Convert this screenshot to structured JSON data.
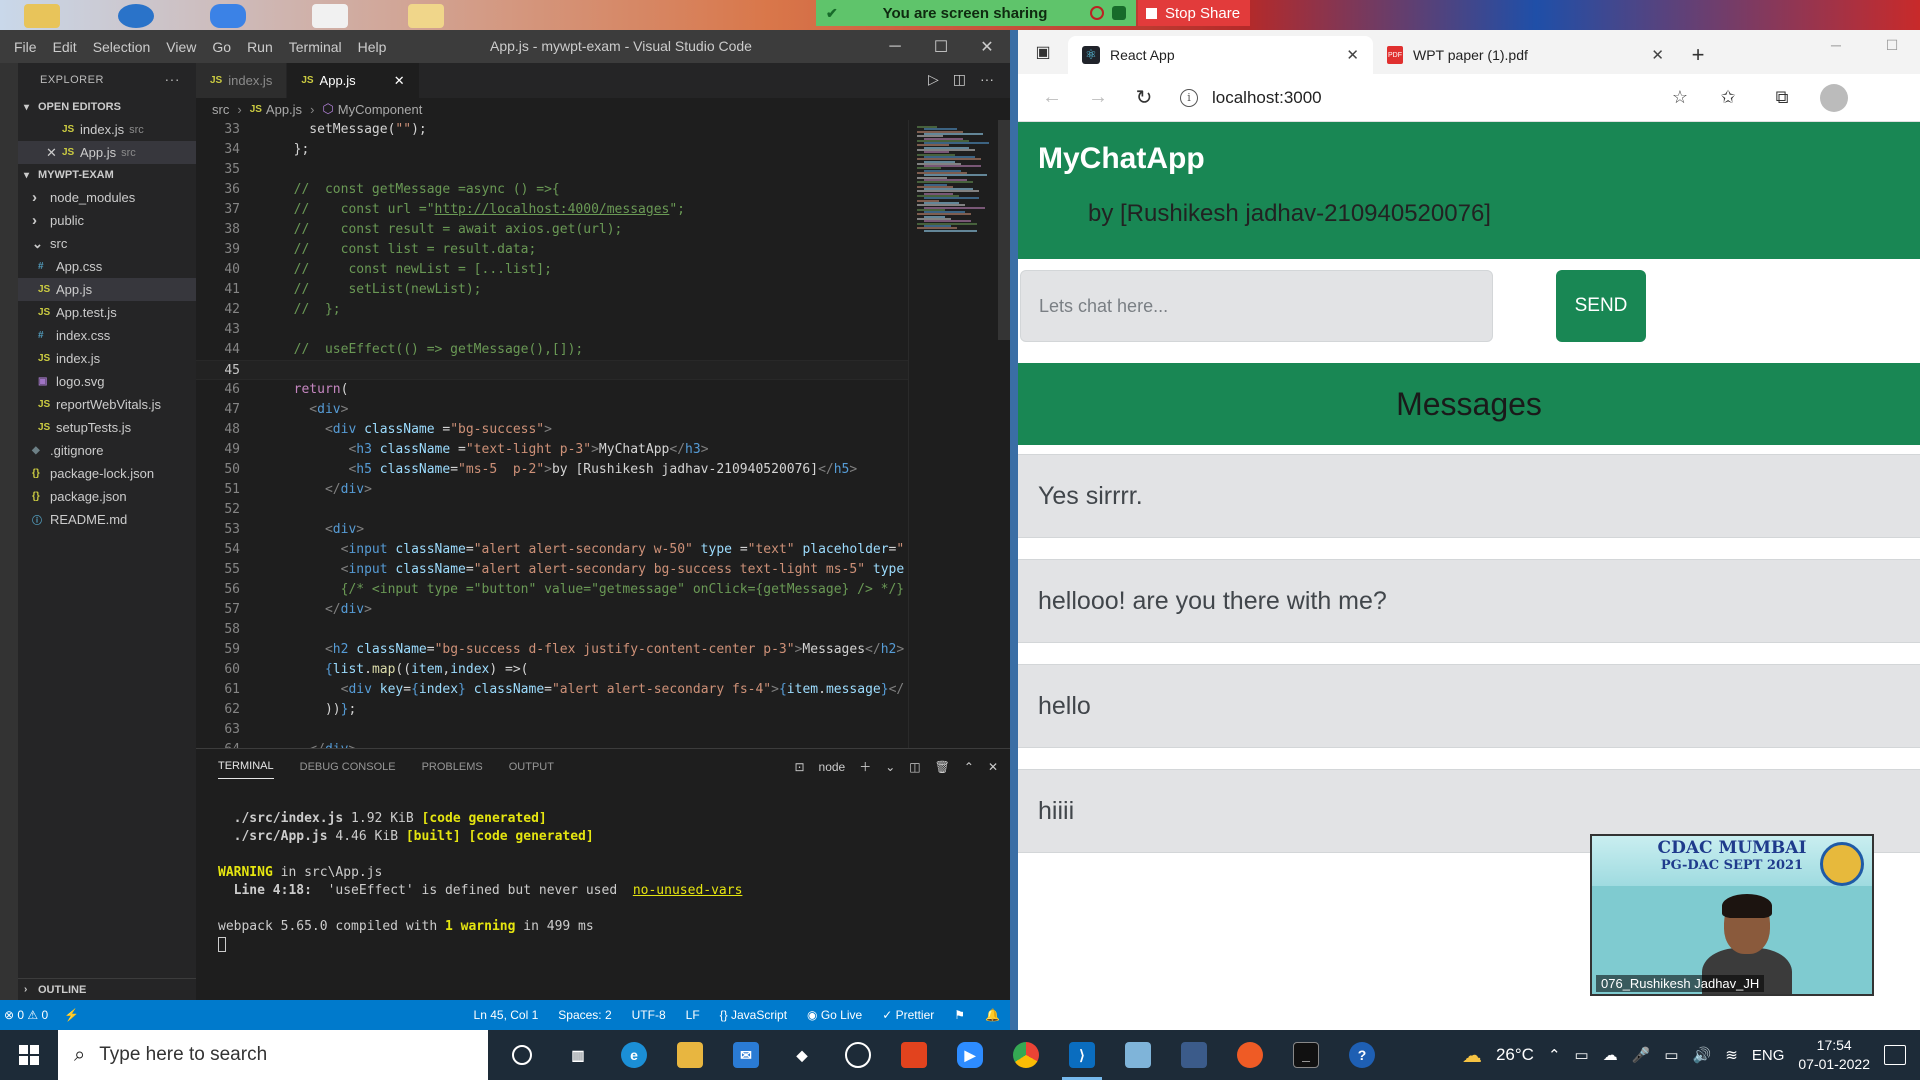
{
  "colors": {
    "vscode_bg": "#1e1e1e",
    "status_bar": "#007acc",
    "bootstrap_success": "#198754",
    "alert_secondary": "#e2e3e5",
    "share_green": "#5fc46b",
    "stop_red": "#e23b3b"
  },
  "screen_share": {
    "message": "You are screen sharing",
    "stop_label": "Stop Share"
  },
  "vscode": {
    "menu": [
      "File",
      "Edit",
      "Selection",
      "View",
      "Go",
      "Run",
      "Terminal",
      "Help"
    ],
    "window_title": "App.js - mywpt-exam - Visual Studio Code",
    "explorer": {
      "header": "EXPLORER",
      "open_editors_label": "OPEN EDITORS",
      "open_editors": [
        {
          "name": "index.js",
          "hint": "src",
          "icon": "js-icon"
        },
        {
          "name": "App.js",
          "hint": "src",
          "icon": "js-icon"
        }
      ],
      "project_label": "MYWPT-EXAM",
      "tree": [
        {
          "name": "node_modules",
          "kind": "folder",
          "depth": 1
        },
        {
          "name": "public",
          "kind": "folder",
          "depth": 1
        },
        {
          "name": "src",
          "kind": "folder-open",
          "depth": 1
        },
        {
          "name": "App.css",
          "kind": "css",
          "depth": 2
        },
        {
          "name": "App.js",
          "kind": "js",
          "depth": 2,
          "selected": true
        },
        {
          "name": "App.test.js",
          "kind": "js",
          "depth": 2
        },
        {
          "name": "index.css",
          "kind": "css",
          "depth": 2
        },
        {
          "name": "index.js",
          "kind": "js",
          "depth": 2
        },
        {
          "name": "logo.svg",
          "kind": "svg",
          "depth": 2
        },
        {
          "name": "reportWebVitals.js",
          "kind": "js",
          "depth": 2
        },
        {
          "name": "setupTests.js",
          "kind": "js",
          "depth": 2
        },
        {
          "name": ".gitignore",
          "kind": "git",
          "depth": 1
        },
        {
          "name": "package-lock.json",
          "kind": "json",
          "depth": 1
        },
        {
          "name": "package.json",
          "kind": "json",
          "depth": 1
        },
        {
          "name": "README.md",
          "kind": "info",
          "depth": 1
        }
      ],
      "outline_label": "OUTLINE"
    },
    "tabs": [
      {
        "label": "index.js",
        "active": false
      },
      {
        "label": "App.js",
        "active": true
      }
    ],
    "breadcrumb": [
      "src",
      "App.js",
      "MyComponent"
    ],
    "current_line": 45,
    "code_lines": [
      {
        "n": 33,
        "parts": [
          [
            "txt",
            "    setMessage("
          ],
          [
            "str",
            "\"\""
          ],
          [
            "txt",
            ");"
          ]
        ]
      },
      {
        "n": 34,
        "parts": [
          [
            "txt",
            "  };"
          ]
        ]
      },
      {
        "n": 35,
        "parts": []
      },
      {
        "n": 36,
        "parts": [
          [
            "com",
            "  //  const getMessage =async () =>{"
          ]
        ]
      },
      {
        "n": 37,
        "parts": [
          [
            "com",
            "  //    const url =\""
          ],
          [
            "link",
            "http://localhost:4000/messages"
          ],
          [
            "com",
            "\";"
          ]
        ]
      },
      {
        "n": 38,
        "parts": [
          [
            "com",
            "  //    const result = await axios.get(url);"
          ]
        ]
      },
      {
        "n": 39,
        "parts": [
          [
            "com",
            "  //    const list = result.data;"
          ]
        ]
      },
      {
        "n": 40,
        "parts": [
          [
            "com",
            "  //     const newList = [...list];"
          ]
        ]
      },
      {
        "n": 41,
        "parts": [
          [
            "com",
            "  //     setList(newList);"
          ]
        ]
      },
      {
        "n": 42,
        "parts": [
          [
            "com",
            "  //  };"
          ]
        ]
      },
      {
        "n": 43,
        "parts": []
      },
      {
        "n": 44,
        "parts": [
          [
            "com",
            "  //  useEffect(() => getMessage(),[]);"
          ]
        ]
      },
      {
        "n": 45,
        "parts": []
      },
      {
        "n": 46,
        "parts": [
          [
            "kw",
            "  return"
          ],
          [
            "txt",
            "("
          ]
        ]
      },
      {
        "n": 47,
        "parts": [
          [
            "tagbr",
            "    <"
          ],
          [
            "tag",
            "div"
          ],
          [
            "tagbr",
            ">"
          ]
        ]
      },
      {
        "n": 48,
        "parts": [
          [
            "tagbr",
            "      <"
          ],
          [
            "tag",
            "div"
          ],
          [
            "attr",
            " className "
          ],
          [
            "txt",
            "="
          ],
          [
            "str",
            "\"bg-success\""
          ],
          [
            "tagbr",
            ">"
          ]
        ]
      },
      {
        "n": 49,
        "parts": [
          [
            "tagbr",
            "         <"
          ],
          [
            "tag",
            "h3"
          ],
          [
            "attr",
            " className "
          ],
          [
            "txt",
            "="
          ],
          [
            "str",
            "\"text-light p-3\""
          ],
          [
            "tagbr",
            ">"
          ],
          [
            "txt",
            "MyChatApp"
          ],
          [
            "tagbr",
            "</"
          ],
          [
            "tag",
            "h3"
          ],
          [
            "tagbr",
            ">"
          ]
        ]
      },
      {
        "n": 50,
        "parts": [
          [
            "tagbr",
            "         <"
          ],
          [
            "tag",
            "h5"
          ],
          [
            "attr",
            " className"
          ],
          [
            "txt",
            "="
          ],
          [
            "str",
            "\"ms-5  p-2\""
          ],
          [
            "tagbr",
            ">"
          ],
          [
            "txt",
            "by [Rushikesh jadhav-210940520076]"
          ],
          [
            "tagbr",
            "</"
          ],
          [
            "tag",
            "h5"
          ],
          [
            "tagbr",
            ">"
          ]
        ]
      },
      {
        "n": 51,
        "parts": [
          [
            "tagbr",
            "      </"
          ],
          [
            "tag",
            "div"
          ],
          [
            "tagbr",
            ">"
          ]
        ]
      },
      {
        "n": 52,
        "parts": []
      },
      {
        "n": 53,
        "parts": [
          [
            "tagbr",
            "      <"
          ],
          [
            "tag",
            "div"
          ],
          [
            "tagbr",
            ">"
          ]
        ]
      },
      {
        "n": 54,
        "parts": [
          [
            "tagbr",
            "        <"
          ],
          [
            "tag",
            "input"
          ],
          [
            "attr",
            " className"
          ],
          [
            "txt",
            "="
          ],
          [
            "str",
            "\"alert alert-secondary w-50\""
          ],
          [
            "attr",
            " type "
          ],
          [
            "txt",
            "="
          ],
          [
            "str",
            "\"text\""
          ],
          [
            "attr",
            " placeholder"
          ],
          [
            "txt",
            "="
          ],
          [
            "str",
            "\""
          ]
        ]
      },
      {
        "n": 55,
        "parts": [
          [
            "tagbr",
            "        <"
          ],
          [
            "tag",
            "input"
          ],
          [
            "attr",
            " className"
          ],
          [
            "txt",
            "="
          ],
          [
            "str",
            "\"alert alert-secondary bg-success text-light ms-5\""
          ],
          [
            "attr",
            " type"
          ]
        ]
      },
      {
        "n": 56,
        "parts": [
          [
            "com",
            "        {/* <input type =\"button\" value=\"getmessage\" onClick={getMessage} /> */}"
          ]
        ]
      },
      {
        "n": 57,
        "parts": [
          [
            "tagbr",
            "      </"
          ],
          [
            "tag",
            "div"
          ],
          [
            "tagbr",
            ">"
          ]
        ]
      },
      {
        "n": 58,
        "parts": []
      },
      {
        "n": 59,
        "parts": [
          [
            "tagbr",
            "      <"
          ],
          [
            "tag",
            "h2"
          ],
          [
            "attr",
            " className"
          ],
          [
            "txt",
            "="
          ],
          [
            "str",
            "\"bg-success d-flex justify-content-center p-3\""
          ],
          [
            "tagbr",
            ">"
          ],
          [
            "txt",
            "Messages"
          ],
          [
            "tagbr",
            "</"
          ],
          [
            "tag",
            "h2"
          ],
          [
            "tagbr",
            ">"
          ]
        ]
      },
      {
        "n": 60,
        "parts": [
          [
            "brace",
            "      {"
          ],
          [
            "var",
            "list"
          ],
          [
            "txt",
            "."
          ],
          [
            "fn",
            "map"
          ],
          [
            "txt",
            "(("
          ],
          [
            "var",
            "item"
          ],
          [
            "txt",
            ","
          ],
          [
            "var",
            "index"
          ],
          [
            "txt",
            ") =>("
          ]
        ]
      },
      {
        "n": 61,
        "parts": [
          [
            "tagbr",
            "        <"
          ],
          [
            "tag",
            "div"
          ],
          [
            "attr",
            " key"
          ],
          [
            "txt",
            "="
          ],
          [
            "brace",
            "{"
          ],
          [
            "var",
            "index"
          ],
          [
            "brace",
            "}"
          ],
          [
            "attr",
            " className"
          ],
          [
            "txt",
            "="
          ],
          [
            "str",
            "\"alert alert-secondary fs-4\""
          ],
          [
            "tagbr",
            ">"
          ],
          [
            "brace",
            "{"
          ],
          [
            "var",
            "item"
          ],
          [
            "txt",
            "."
          ],
          [
            "var",
            "message"
          ],
          [
            "brace",
            "}"
          ],
          [
            "tagbr",
            "</"
          ]
        ]
      },
      {
        "n": 62,
        "parts": [
          [
            "txt",
            "      ))"
          ],
          [
            "brace",
            "}"
          ],
          [
            "txt",
            ";"
          ]
        ]
      },
      {
        "n": 63,
        "parts": []
      },
      {
        "n": 64,
        "parts": [
          [
            "tagbr",
            "    </"
          ],
          [
            "tag",
            "div"
          ],
          [
            "tagbr",
            ">"
          ]
        ]
      }
    ],
    "panel": {
      "tabs": [
        "TERMINAL",
        "DEBUG CONSOLE",
        "PROBLEMS",
        "OUTPUT"
      ],
      "shell": "node",
      "lines": [
        [],
        [
          [
            "bold",
            "  ./src/index.js"
          ],
          [
            "txt",
            " 1.92 KiB "
          ],
          [
            "yel",
            "[code generated]"
          ]
        ],
        [
          [
            "bold",
            "  ./src/App.js"
          ],
          [
            "txt",
            " 4.46 KiB "
          ],
          [
            "yel",
            "[built] [code generated]"
          ]
        ],
        [],
        [
          [
            "yel",
            "WARNING"
          ],
          [
            "txt",
            " in src\\App.js"
          ]
        ],
        [
          [
            "bold",
            "  Line 4:18:"
          ],
          [
            "txt",
            "  'useEffect' is defined but never used  "
          ],
          [
            "link",
            "no-unused-vars"
          ]
        ],
        [],
        [
          [
            "txt",
            "webpack 5.65.0 compiled with "
          ],
          [
            "yel",
            "1 warning"
          ],
          [
            "txt",
            " in 499 ms"
          ]
        ]
      ]
    },
    "status": {
      "errors_warnings": "⊗ 0 ⚠ 0",
      "position": "Ln 45, Col 1",
      "spaces": "Spaces: 2",
      "encoding": "UTF-8",
      "eol": "LF",
      "language": "{} JavaScript",
      "golive": "Go Live",
      "prettier": "✓ Prettier"
    }
  },
  "browser": {
    "tabs": [
      {
        "title": "React App",
        "active": true
      },
      {
        "title": "WPT paper (1).pdf",
        "active": false
      }
    ],
    "url": "localhost:3000",
    "app": {
      "title": "MyChatApp",
      "subtitle": "by [Rushikesh jadhav-210940520076]",
      "input_placeholder": "Lets chat here...",
      "send_label": "SEND",
      "messages_heading": "Messages",
      "messages": [
        "Yes sirrrr.",
        "hellooo! are you there with me?",
        "hello",
        "hiiii"
      ]
    }
  },
  "video_tile": {
    "title": "CDAC MUMBAI",
    "subtitle": "PG-DAC SEPT 2021",
    "name": "076_Rushikesh Jadhav_JH"
  },
  "taskbar": {
    "search_placeholder": "Type here to search",
    "temperature": "26°C",
    "language": "ENG",
    "time": "17:54",
    "date": "07-01-2022"
  }
}
